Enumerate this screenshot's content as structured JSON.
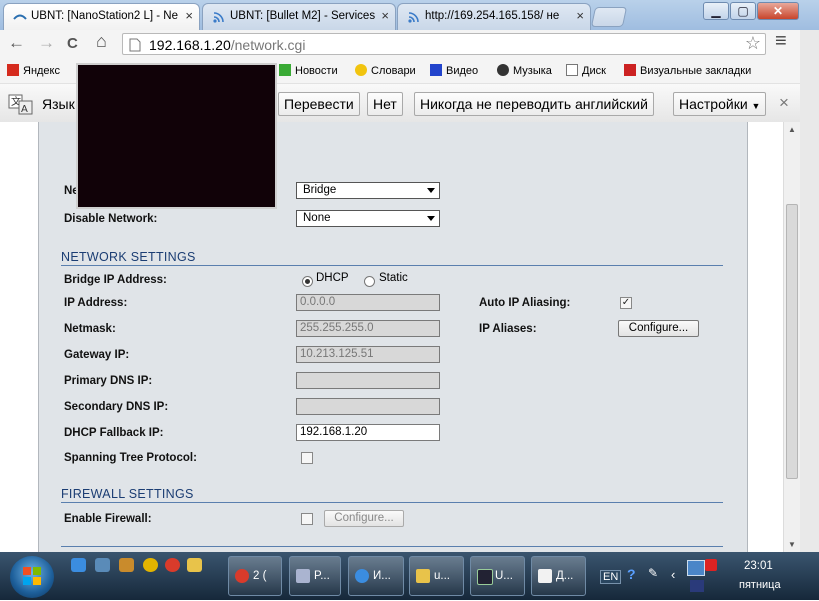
{
  "tabs": [
    {
      "label": "UBNT: [NanoStation2 L] - Ne",
      "close": "×",
      "icon": "ubnt-icon"
    },
    {
      "label": "UBNT: [Bullet M2] - Services",
      "close": "×",
      "icon": "wifi-icon"
    },
    {
      "label": "http://169.254.165.158/ не",
      "close": "×",
      "icon": "wifi-icon"
    }
  ],
  "window": {
    "minimize": "▁",
    "maximize": "▢",
    "close": "✕"
  },
  "toolbar": {
    "back": "←",
    "forward": "→",
    "reload": "C",
    "home": "⌂",
    "menu": "≡"
  },
  "address": {
    "host": "192.168.1.20",
    "path": "/network.cgi",
    "star": "☆"
  },
  "bookmarks": [
    {
      "label": "Яндекс",
      "icon": "yandex-icon",
      "color": "#d52b1e"
    },
    {
      "label": "Новости",
      "icon": "news-icon",
      "color": "#3aaa35"
    },
    {
      "label": "Словари",
      "icon": "dictionary-icon",
      "color": "#f1c40f"
    },
    {
      "label": "Видео",
      "icon": "video-icon",
      "color": "#2244cc"
    },
    {
      "label": "Музыка",
      "icon": "music-icon",
      "color": "#333333"
    },
    {
      "label": "Диск",
      "icon": "disk-icon",
      "color": "#777777"
    },
    {
      "label": "Визуальные закладки",
      "icon": "visual-bookmarks-icon",
      "color": "#cc2222"
    }
  ],
  "translate": {
    "lang_label": "Язык",
    "translate_btn": "Перевести",
    "no_btn": "Нет",
    "never_btn": "Никогда не переводить английский",
    "settings_btn": "Настройки",
    "close": "×"
  },
  "form": {
    "network_mode_label": "Ne",
    "network_mode_value": "Bridge",
    "disable_network_label": "Disable Network:",
    "disable_network_value": "None",
    "network_settings_title": "NETWORK SETTINGS",
    "bridge_ip_label": "Bridge IP Address:",
    "dhcp_label": "DHCP",
    "static_label": "Static",
    "ip_label": "IP Address:",
    "ip_value": "0.0.0.0",
    "netmask_label": "Netmask:",
    "netmask_value": "255.255.255.0",
    "gateway_label": "Gateway IP:",
    "gateway_value": "10.213.125.51",
    "primary_dns_label": "Primary DNS IP:",
    "primary_dns_value": "",
    "secondary_dns_label": "Secondary DNS IP:",
    "secondary_dns_value": "",
    "dhcp_fallback_label": "DHCP Fallback IP:",
    "dhcp_fallback_value": "192.168.1.20",
    "stp_label": "Spanning Tree Protocol:",
    "auto_alias_label": "Auto IP Aliasing:",
    "auto_alias_check": "✓",
    "ip_aliases_label": "IP Aliases:",
    "configure_btn": "Configure...",
    "firewall_title": "FIREWALL SETTINGS",
    "enable_firewall_label": "Enable Firewall:",
    "firewall_configure_btn": "Configure..."
  },
  "taskbar": {
    "tasks": [
      {
        "label": "2 (",
        "icon": "chrome-icon"
      },
      {
        "label": "P...",
        "icon": "app-icon"
      },
      {
        "label": "И...",
        "icon": "ie-icon"
      },
      {
        "label": "u...",
        "icon": "folder-icon"
      },
      {
        "label": "U...",
        "icon": "monitor-icon"
      },
      {
        "label": "Д...",
        "icon": "document-icon"
      }
    ],
    "lang": "EN",
    "time": "23:01",
    "day": "пятница"
  }
}
